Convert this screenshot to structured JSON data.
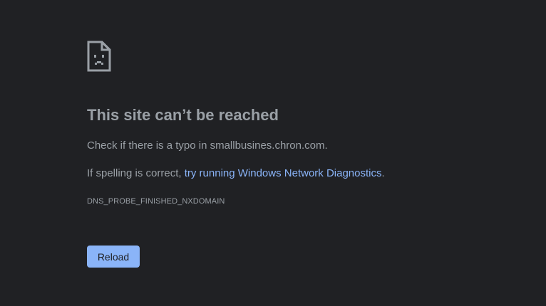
{
  "error_page": {
    "icon": "sad-document-icon",
    "title": "This site can’t be reached",
    "typo_text": "Check if there is a typo in smallbusines.chron.com.",
    "spelling_prefix": "If spelling is correct, ",
    "diagnostics_link": "try running Windows Network Diagnostics",
    "spelling_suffix": ".",
    "error_code": "DNS_PROBE_FINISHED_NXDOMAIN",
    "reload_label": "Reload"
  },
  "colors": {
    "background": "#202124",
    "text": "#9aa0a6",
    "link": "#8ab4f8",
    "button": "#8ab4f8"
  }
}
